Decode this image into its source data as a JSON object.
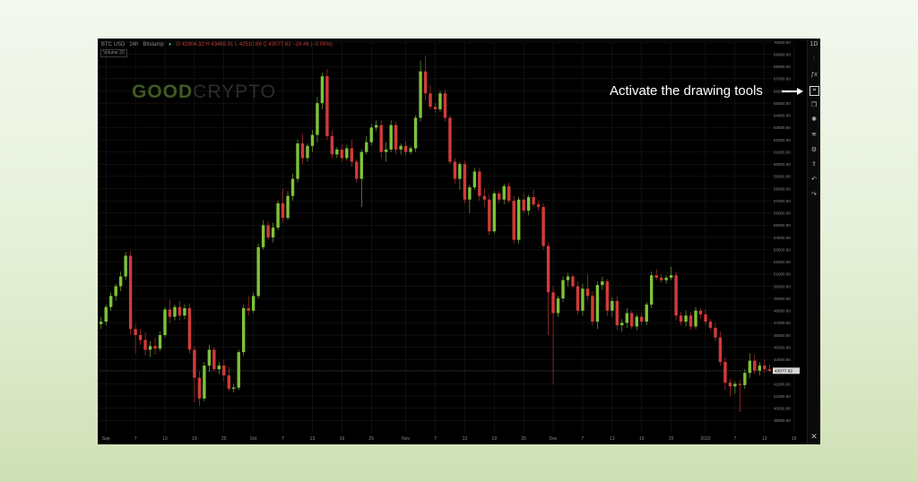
{
  "header": {
    "symbol": "BTC USD",
    "interval": "24h",
    "exchange": "Bitstamp",
    "ohlc": "O 42904.32  H 43465.91  L 42510.66  C 43077.82  −24.46 (−0.06%)",
    "volume_label": "Volume 20"
  },
  "logo": {
    "part1": "GOOD",
    "part2": "CRYPTO"
  },
  "callout": {
    "text": "Activate the drawing tools"
  },
  "toolbar": {
    "timeframe": "1D",
    "icons": [
      "candles-icon",
      "indicators-icon",
      "drawing-tools-icon",
      "compare-icon",
      "settings-wheel-icon",
      "layers-icon",
      "gear-icon",
      "share-icon",
      "undo-icon",
      "redo-icon",
      "close-icon"
    ]
  },
  "colors": {
    "up": "#7ec23a",
    "down": "#d33a3a",
    "background": "#000000",
    "grid": "#1e1e1e",
    "axis_text": "#8a8a8a"
  },
  "chart_data": {
    "type": "candlestick",
    "ylim": [
      38000,
      70000
    ],
    "y_ticks": [
      39000,
      40000,
      41000,
      42000,
      43000,
      44000,
      45000,
      46000,
      47000,
      48000,
      49000,
      50000,
      51000,
      52000,
      53000,
      54000,
      55000,
      56000,
      57000,
      58000,
      59000,
      60000,
      61000,
      62000,
      63000,
      64000,
      65000,
      66000,
      67000,
      68000,
      69000,
      70000
    ],
    "y_tick_labels": [
      "39000.00",
      "40000.00",
      "41000.00",
      "42000.00",
      "43000.00",
      "44000.00",
      "45000.00",
      "46000.00",
      "47000.00",
      "48000.00",
      "49000.00",
      "50000.00",
      "51000.00",
      "52000.00",
      "53000.00",
      "54000.00",
      "55000.00",
      "56000.00",
      "57000.00",
      "58000.00",
      "59000.00",
      "60000.00",
      "61000.00",
      "62000.00",
      "63000.00",
      "64000.00",
      "65000.00",
      "66000.00",
      "67000.00",
      "68000.00",
      "69000.00",
      "70000.00"
    ],
    "x_ticks": [
      {
        "label": "Sep",
        "index": 1
      },
      {
        "label": "7",
        "index": 7
      },
      {
        "label": "13",
        "index": 13
      },
      {
        "label": "19",
        "index": 19
      },
      {
        "label": "25",
        "index": 25
      },
      {
        "label": "Oct",
        "index": 31
      },
      {
        "label": "7",
        "index": 37
      },
      {
        "label": "13",
        "index": 43
      },
      {
        "label": "19",
        "index": 49
      },
      {
        "label": "25",
        "index": 55
      },
      {
        "label": "Nov",
        "index": 62
      },
      {
        "label": "7",
        "index": 68
      },
      {
        "label": "13",
        "index": 74
      },
      {
        "label": "19",
        "index": 80
      },
      {
        "label": "25",
        "index": 86
      },
      {
        "label": "Dec",
        "index": 92
      },
      {
        "label": "7",
        "index": 98
      },
      {
        "label": "13",
        "index": 104
      },
      {
        "label": "19",
        "index": 110
      },
      {
        "label": "25",
        "index": 116
      },
      {
        "label": "2022",
        "index": 123
      },
      {
        "label": "7",
        "index": 129
      },
      {
        "label": "13",
        "index": 135
      },
      {
        "label": "19",
        "index": 141
      }
    ],
    "last_price": 43077.82,
    "last_price_label": "43077.82",
    "candles": [
      [
        46900,
        47500,
        46500,
        47100
      ],
      [
        47100,
        48500,
        46800,
        48300
      ],
      [
        48300,
        49500,
        48000,
        49200
      ],
      [
        49200,
        50200,
        48800,
        50000
      ],
      [
        50000,
        51200,
        49600,
        50800
      ],
      [
        50800,
        52800,
        50500,
        52500
      ],
      [
        52500,
        52900,
        46000,
        46500
      ],
      [
        46500,
        46900,
        44500,
        46000
      ],
      [
        46000,
        46500,
        45200,
        45600
      ],
      [
        45600,
        46200,
        44300,
        44800
      ],
      [
        44800,
        45500,
        44200,
        45100
      ],
      [
        45100,
        45800,
        44400,
        44900
      ],
      [
        44900,
        46300,
        44700,
        46000
      ],
      [
        46000,
        48300,
        45800,
        48100
      ],
      [
        48100,
        48900,
        47000,
        47500
      ],
      [
        47500,
        48500,
        47200,
        48300
      ],
      [
        48300,
        48800,
        47200,
        47600
      ],
      [
        47600,
        48500,
        47300,
        48200
      ],
      [
        48200,
        48600,
        44500,
        44800
      ],
      [
        44800,
        45100,
        40500,
        42500
      ],
      [
        42500,
        43000,
        40200,
        40800
      ],
      [
        40800,
        43800,
        40600,
        43500
      ],
      [
        43500,
        45200,
        43000,
        44800
      ],
      [
        44800,
        45000,
        43000,
        43200
      ],
      [
        43200,
        43800,
        42800,
        43500
      ],
      [
        43500,
        44000,
        42200,
        42700
      ],
      [
        42700,
        43400,
        41400,
        41600
      ],
      [
        41600,
        42000,
        41300,
        41700
      ],
      [
        41700,
        44800,
        41500,
        44600
      ],
      [
        44600,
        48500,
        44300,
        48200
      ],
      [
        48200,
        49200,
        47600,
        48000
      ],
      [
        48000,
        49500,
        47800,
        49200
      ],
      [
        49200,
        53500,
        49000,
        53200
      ],
      [
        53200,
        55400,
        53000,
        55000
      ],
      [
        55000,
        55300,
        53800,
        54000
      ],
      [
        54000,
        55200,
        53600,
        54800
      ],
      [
        54800,
        57000,
        54600,
        56800
      ],
      [
        56800,
        58000,
        55200,
        55600
      ],
      [
        55600,
        57800,
        55400,
        57400
      ],
      [
        57400,
        59200,
        57000,
        58800
      ],
      [
        58800,
        62000,
        58500,
        61700
      ],
      [
        61700,
        62500,
        60000,
        60500
      ],
      [
        60500,
        61700,
        60200,
        61500
      ],
      [
        61500,
        62800,
        61000,
        62400
      ],
      [
        62400,
        65500,
        61800,
        65000
      ],
      [
        65000,
        67500,
        64500,
        67200
      ],
      [
        67200,
        67800,
        62000,
        62300
      ],
      [
        62300,
        62800,
        60500,
        60800
      ],
      [
        60800,
        61400,
        60500,
        61200
      ],
      [
        61200,
        61600,
        60200,
        60500
      ],
      [
        60500,
        61600,
        60300,
        61300
      ],
      [
        61300,
        62000,
        59800,
        60200
      ],
      [
        60200,
        60400,
        58500,
        58800
      ],
      [
        58800,
        61200,
        56500,
        61000
      ],
      [
        61000,
        62300,
        60800,
        61800
      ],
      [
        61800,
        63300,
        61500,
        63000
      ],
      [
        63000,
        63600,
        62700,
        63200
      ],
      [
        63200,
        63600,
        60500,
        61000
      ],
      [
        61000,
        61800,
        60200,
        61200
      ],
      [
        61200,
        63600,
        61000,
        63200
      ],
      [
        63200,
        63500,
        60800,
        61200
      ],
      [
        61200,
        61700,
        60800,
        61500
      ],
      [
        61500,
        61900,
        60700,
        61000
      ],
      [
        61000,
        61500,
        60800,
        61300
      ],
      [
        61300,
        64000,
        61000,
        63800
      ],
      [
        63800,
        68500,
        63500,
        67600
      ],
      [
        67600,
        68900,
        65200,
        65800
      ],
      [
        65800,
        66500,
        64500,
        64700
      ],
      [
        64700,
        65000,
        64200,
        64500
      ],
      [
        64500,
        66000,
        64300,
        65800
      ],
      [
        65800,
        66100,
        63500,
        63800
      ],
      [
        63800,
        64000,
        60000,
        60200
      ],
      [
        60200,
        60500,
        58400,
        58800
      ],
      [
        58800,
        60200,
        57900,
        60000
      ],
      [
        60000,
        60300,
        56800,
        57100
      ],
      [
        57100,
        58300,
        56000,
        58100
      ],
      [
        58100,
        59700,
        57900,
        59400
      ],
      [
        59400,
        59700,
        57000,
        57400
      ],
      [
        57400,
        58000,
        56500,
        57100
      ],
      [
        57100,
        57500,
        54200,
        54500
      ],
      [
        54500,
        57800,
        54300,
        57600
      ],
      [
        57600,
        57800,
        56800,
        57100
      ],
      [
        57100,
        58400,
        56700,
        58200
      ],
      [
        58200,
        58500,
        56800,
        57000
      ],
      [
        57000,
        57400,
        53500,
        53800
      ],
      [
        53800,
        57300,
        53500,
        57100
      ],
      [
        57100,
        57600,
        56000,
        56200
      ],
      [
        56200,
        57500,
        55800,
        57300
      ],
      [
        57300,
        57900,
        56500,
        56700
      ],
      [
        56700,
        57000,
        56200,
        56500
      ],
      [
        56500,
        56800,
        53000,
        53300
      ],
      [
        53300,
        53600,
        46000,
        49500
      ],
      [
        49500,
        50000,
        42000,
        47800
      ],
      [
        47800,
        49200,
        47500,
        49000
      ],
      [
        49000,
        50800,
        48700,
        50500
      ],
      [
        50500,
        51100,
        50000,
        50800
      ],
      [
        50800,
        51000,
        49800,
        50000
      ],
      [
        50000,
        50400,
        47700,
        48000
      ],
      [
        48000,
        50200,
        47600,
        49800
      ],
      [
        49800,
        51000,
        48800,
        49200
      ],
      [
        49200,
        49600,
        46800,
        47100
      ],
      [
        47100,
        50400,
        46500,
        50100
      ],
      [
        50100,
        50800,
        49700,
        50400
      ],
      [
        50400,
        50600,
        47600,
        48000
      ],
      [
        48000,
        49100,
        47500,
        48800
      ],
      [
        48800,
        49200,
        46400,
        46800
      ],
      [
        46800,
        47300,
        46300,
        47000
      ],
      [
        47000,
        48200,
        46600,
        47800
      ],
      [
        47800,
        48000,
        46500,
        46700
      ],
      [
        46700,
        47700,
        46400,
        47500
      ],
      [
        47500,
        47800,
        46800,
        47100
      ],
      [
        47100,
        48700,
        46800,
        48500
      ],
      [
        48500,
        51200,
        48200,
        50900
      ],
      [
        50900,
        51400,
        50500,
        50700
      ],
      [
        50700,
        51000,
        50300,
        50500
      ],
      [
        50500,
        50900,
        50200,
        50700
      ],
      [
        50700,
        51600,
        50500,
        50900
      ],
      [
        50900,
        51200,
        47200,
        47600
      ],
      [
        47600,
        47900,
        46800,
        47100
      ],
      [
        47100,
        48000,
        46700,
        47600
      ],
      [
        47600,
        47900,
        46400,
        46700
      ],
      [
        46700,
        48300,
        46500,
        48000
      ],
      [
        48000,
        48200,
        47300,
        47700
      ],
      [
        47700,
        48100,
        46800,
        47100
      ],
      [
        47100,
        47300,
        46400,
        46600
      ],
      [
        46600,
        47000,
        45500,
        45800
      ],
      [
        45800,
        46300,
        43500,
        43800
      ],
      [
        43800,
        44200,
        41500,
        42100
      ],
      [
        42100,
        42400,
        41000,
        41800
      ],
      [
        41800,
        42200,
        41200,
        42000
      ],
      [
        42000,
        42300,
        39700,
        41900
      ],
      [
        41900,
        43200,
        41600,
        42900
      ],
      [
        42900,
        44500,
        42500,
        43900
      ],
      [
        43900,
        44400,
        42800,
        43100
      ],
      [
        43100,
        43800,
        42700,
        43500
      ],
      [
        43500,
        44000,
        42900,
        43200
      ],
      [
        43200,
        43600,
        43000,
        43078
      ]
    ]
  }
}
